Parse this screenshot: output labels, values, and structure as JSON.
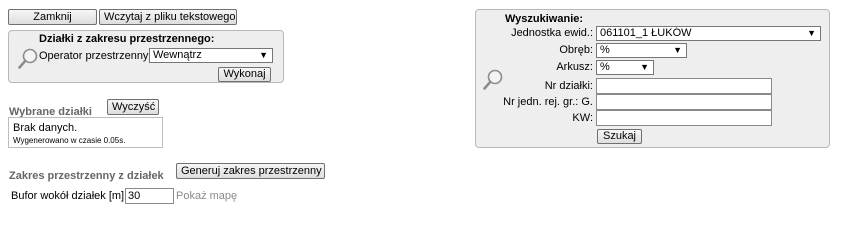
{
  "toolbar": {
    "close_label": "Zamknij",
    "load_file_label": "Wczytaj z pliku tekstowego"
  },
  "spatial_panel": {
    "title": "Działki z zakresu przestrzennego:",
    "operator_label": "Operator przestrzenny:",
    "operator_value": "Wewnątrz",
    "execute_label": "Wykonaj"
  },
  "selected": {
    "title": "Wybrane działki",
    "clear_label": "Wyczyść",
    "empty_text": "Brak danych.",
    "generated_text": "Wygenerowano w czasie 0.05s."
  },
  "range": {
    "title": "Zakres przestrzenny z działek",
    "generate_label": "Generuj zakres przestrzenny",
    "buffer_label": "Bufor wokół działek [m]:",
    "buffer_value": "30",
    "show_map_label": "Pokaż mapę"
  },
  "search": {
    "title": "Wyszukiwanie:",
    "unit_label": "Jednostka ewid.:",
    "unit_value": "061101_1 ŁUKÓW",
    "obreb_label": "Obręb:",
    "obreb_value": "%",
    "arkusz_label": "Arkusz:",
    "arkusz_value": "%",
    "parcel_label": "Nr działki:",
    "parcel_value": "",
    "jrg_label": "Nr jedn. rej. gr.: G.",
    "jrg_value": "",
    "kw_label": "KW:",
    "kw_value": "",
    "search_label": "Szukaj"
  },
  "icons": {
    "spatial_search": "magnifier-icon",
    "search_panel": "magnifier-icon"
  }
}
